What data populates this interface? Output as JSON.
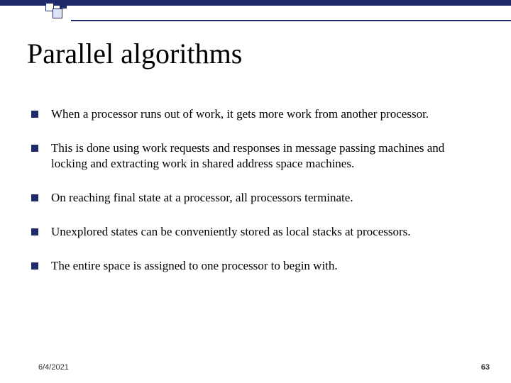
{
  "slide": {
    "title": "Parallel algorithms",
    "bullets": [
      "When a processor runs out of work, it gets more work from another processor.",
      "This is done using work requests and responses in message passing machines and locking and extracting work in shared address space machines.",
      "On reaching final state at a processor, all processors terminate.",
      "Unexplored states can be conveniently stored as local stacks at processors.",
      "The entire space is assigned to one processor to begin with."
    ],
    "footer": {
      "date": "6/4/2021",
      "page": "63"
    }
  }
}
